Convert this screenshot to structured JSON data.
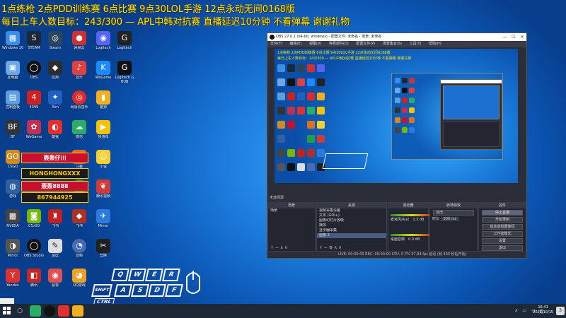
{
  "overlay": {
    "line1": "1点练枪 2点PDD训练赛 6点比赛 9点30LOL手游 12点永动无间0168版",
    "line2": "每日上车人数目标：243/300 — APL中韩对抗赛 直播延迟10分钟 不看弹幕 谢谢礼物"
  },
  "ad": {
    "line1": "轰轰仔川",
    "line2": "HONGHONGXXX",
    "line3": "轰轰8888",
    "line4": "867944925"
  },
  "keyboard": {
    "row1": [
      "Q",
      "W",
      "E",
      "R"
    ],
    "row2": [
      "A",
      "S",
      "D",
      "F"
    ],
    "shift": "SHIFT",
    "ctrl": "CTRL"
  },
  "obs": {
    "title": "OBS 27.0.1 (64-bit, windows) - 配置文件: 未命名 - 场景: 未命名",
    "menu": [
      "文件(F)",
      "编辑(E)",
      "视图(V)",
      "停靠部件(D)",
      "配置文件(P)",
      "场景集合(S)",
      "工具(T)",
      "帮助(H)"
    ],
    "source_bar": "未选择源",
    "scenes": {
      "header": "场景",
      "items": [
        "场景"
      ],
      "footer": "+  −  ∧  ∨"
    },
    "sources": {
      "header": "来源",
      "items": [
        "视频采集设备",
        "文本 (GDI+)",
        "图像幻灯片放映",
        "媒体",
        "显示器采集",
        "图像 2"
      ],
      "footer": "+  −  ⚙  ∧  ∨"
    },
    "mixer": {
      "header": "混音器",
      "tracks": [
        {
          "name": "麦克风/Aux",
          "level": "1.3 dB"
        },
        {
          "name": "桌面音频",
          "level": "0.0 dB"
        }
      ]
    },
    "transitions": {
      "header": "转场特效",
      "type": "淡出",
      "duration_label": "时长",
      "duration": "300 ms"
    },
    "controls": {
      "header": "控件",
      "items": [
        "停止直播",
        "开始录制",
        "启动虚拟摄像机",
        "工作室模式",
        "设置",
        "退出"
      ]
    },
    "status": "LIVE: 00:00:00  REC: 00:00:00  CPU: 0.7%  57.94 fps  延迟 (帧 400 秒后开始)"
  },
  "desktop_icons": [
    {
      "label": "Windows 10"
    },
    {
      "label": "STEAM"
    },
    {
      "label": "Steam"
    },
    {
      "label": "网易云"
    },
    {
      "label": "Logitech"
    },
    {
      "label": "此电脑"
    },
    {
      "label": "OBS"
    },
    {
      "label": "应用"
    },
    {
      "label": "音乐"
    },
    {
      "label": "WeGame"
    },
    {
      "label": "Logitech G HUB"
    },
    {
      "label": "控制面板"
    },
    {
      "label": "4399"
    },
    {
      "label": "Aim"
    },
    {
      "label": "网易云音乐"
    },
    {
      "label": "酷狗"
    },
    {
      "label": "BF"
    },
    {
      "label": "WeGame"
    },
    {
      "label": "酷我"
    },
    {
      "label": "微信"
    },
    {
      "label": "快游戏"
    },
    {
      "label": "CSGO"
    },
    {
      "label": "抖音"
    },
    {
      "label": "HONGHONG"
    },
    {
      "label": "斗鱼"
    },
    {
      "label": "小说"
    },
    {
      "label": "游戏"
    },
    {
      "label": "设置"
    },
    {
      "label": "腾讯视频"
    },
    {
      "label": "NVIDIA"
    },
    {
      "label": "CS:GO"
    },
    {
      "label": "飞书"
    },
    {
      "label": "Mirror"
    },
    {
      "label": "OBS Studio"
    },
    {
      "label": "录屏"
    },
    {
      "label": "音频"
    },
    {
      "label": "剪映"
    },
    {
      "label": "Yandex"
    },
    {
      "label": "腾讯"
    },
    {
      "label": "鼠标"
    },
    {
      "label": "QQ游戏"
    },
    {
      "label": "网易MuMu"
    }
  ],
  "taskbar": {
    "time": "16:41",
    "date": "2021/10/15",
    "lang": "英",
    "notif": "3"
  },
  "colors": {
    "accent": "#ffe600",
    "obs_bg": "#2b2e38"
  }
}
